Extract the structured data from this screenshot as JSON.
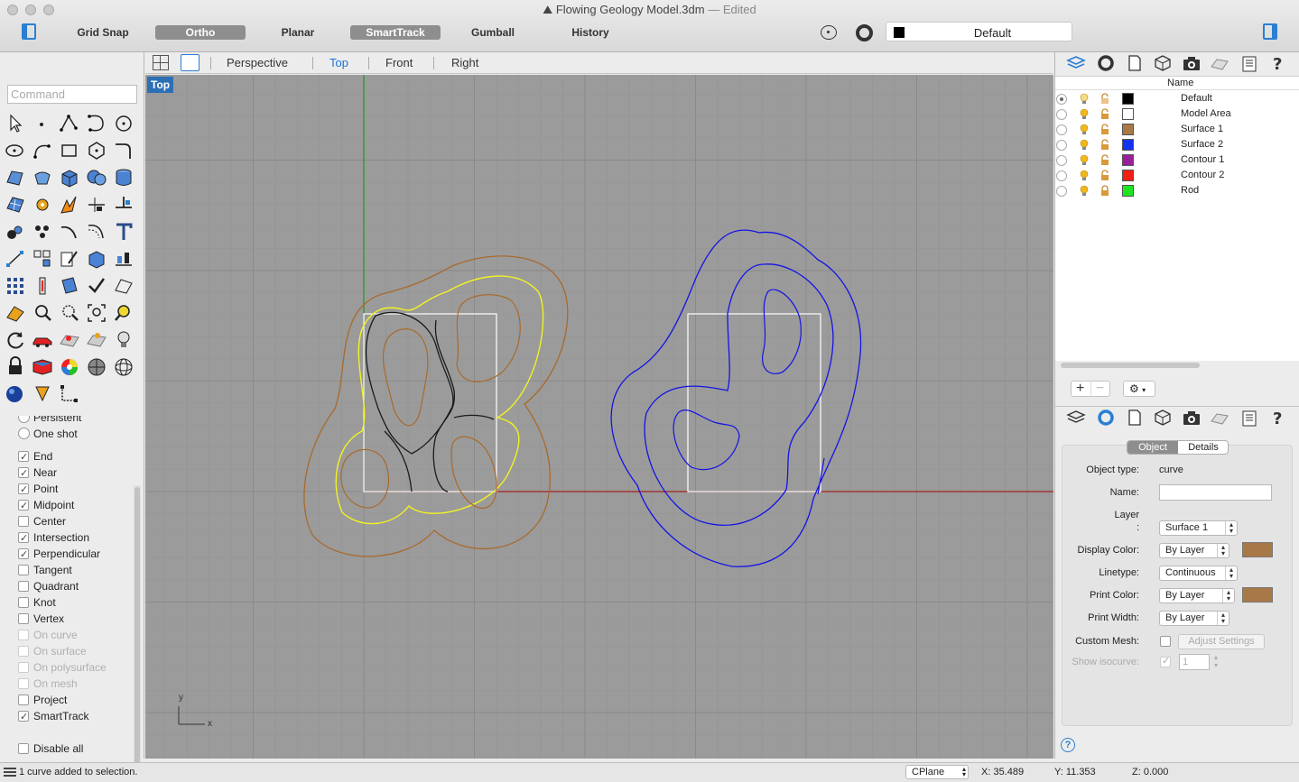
{
  "window": {
    "title": "Flowing Geology Model.3dm",
    "separator": " — ",
    "edited": "Edited"
  },
  "toolbar": {
    "buttons": [
      {
        "label": "Grid Snap",
        "on": false
      },
      {
        "label": "Ortho",
        "on": true
      },
      {
        "label": "Planar",
        "on": false
      },
      {
        "label": "SmartTrack",
        "on": true
      },
      {
        "label": "Gumball",
        "on": false
      },
      {
        "label": "History",
        "on": false
      }
    ],
    "current_layer": "Default"
  },
  "views": {
    "tabs": [
      "Perspective",
      "Top",
      "Front",
      "Right"
    ],
    "active": "Top",
    "viewport_label": "Top"
  },
  "command": {
    "placeholder": "Command"
  },
  "snaps": {
    "persistent": "Persistent",
    "one_shot": "One shot",
    "items": [
      {
        "label": "End",
        "checked": true,
        "enabled": true
      },
      {
        "label": "Near",
        "checked": true,
        "enabled": true
      },
      {
        "label": "Point",
        "checked": true,
        "enabled": true
      },
      {
        "label": "Midpoint",
        "checked": true,
        "enabled": true
      },
      {
        "label": "Center",
        "checked": false,
        "enabled": true
      },
      {
        "label": "Intersection",
        "checked": true,
        "enabled": true
      },
      {
        "label": "Perpendicular",
        "checked": true,
        "enabled": true
      },
      {
        "label": "Tangent",
        "checked": false,
        "enabled": true
      },
      {
        "label": "Quadrant",
        "checked": false,
        "enabled": true
      },
      {
        "label": "Knot",
        "checked": false,
        "enabled": true
      },
      {
        "label": "Vertex",
        "checked": false,
        "enabled": true
      },
      {
        "label": "On curve",
        "checked": false,
        "enabled": false
      },
      {
        "label": "On surface",
        "checked": false,
        "enabled": false
      },
      {
        "label": "On polysurface",
        "checked": false,
        "enabled": false
      },
      {
        "label": "On mesh",
        "checked": false,
        "enabled": false
      },
      {
        "label": "Project",
        "checked": false,
        "enabled": true
      },
      {
        "label": "SmartTrack",
        "checked": true,
        "enabled": true
      }
    ],
    "disable_all": "Disable all"
  },
  "layers": {
    "header_name": "Name",
    "rows": [
      {
        "name": "Default",
        "color": "#000000",
        "current": true
      },
      {
        "name": "Model Area",
        "color": "#ffffff",
        "current": false
      },
      {
        "name": "Surface 1",
        "color": "#a97847",
        "current": false
      },
      {
        "name": "Surface 2",
        "color": "#1432f0",
        "current": false
      },
      {
        "name": "Contour 1",
        "color": "#9a1f9a",
        "current": false
      },
      {
        "name": "Contour 2",
        "color": "#f01e14",
        "current": false
      },
      {
        "name": "Rod",
        "color": "#1ee61e",
        "current": false
      }
    ]
  },
  "properties": {
    "segments": [
      "Object",
      "Details"
    ],
    "object_type_label": "Object type:",
    "object_type": "curve",
    "name_label": "Name:",
    "name_value": "",
    "layer_label": "Layer",
    "layer_colon": ":",
    "layer_value": "Surface 1",
    "display_color_label": "Display Color:",
    "display_color": "By Layer",
    "linetype_label": "Linetype:",
    "linetype": "Continuous",
    "print_color_label": "Print Color:",
    "print_color": "By Layer",
    "print_width_label": "Print Width:",
    "print_width": "By Layer",
    "custom_mesh_label": "Custom Mesh:",
    "adjust_settings": "Adjust Settings",
    "show_isocurve_label": "Show isocurve:",
    "isocurve_count": "1",
    "swatch_color": "#a97847",
    "help": "?"
  },
  "status": {
    "message": "1 curve added to selection.",
    "cplane": "CPlane",
    "x": "X: 35.489",
    "y": "Y: 11.353",
    "z": "Z: 0.000"
  },
  "axes": {
    "x": "x",
    "y": "y"
  }
}
